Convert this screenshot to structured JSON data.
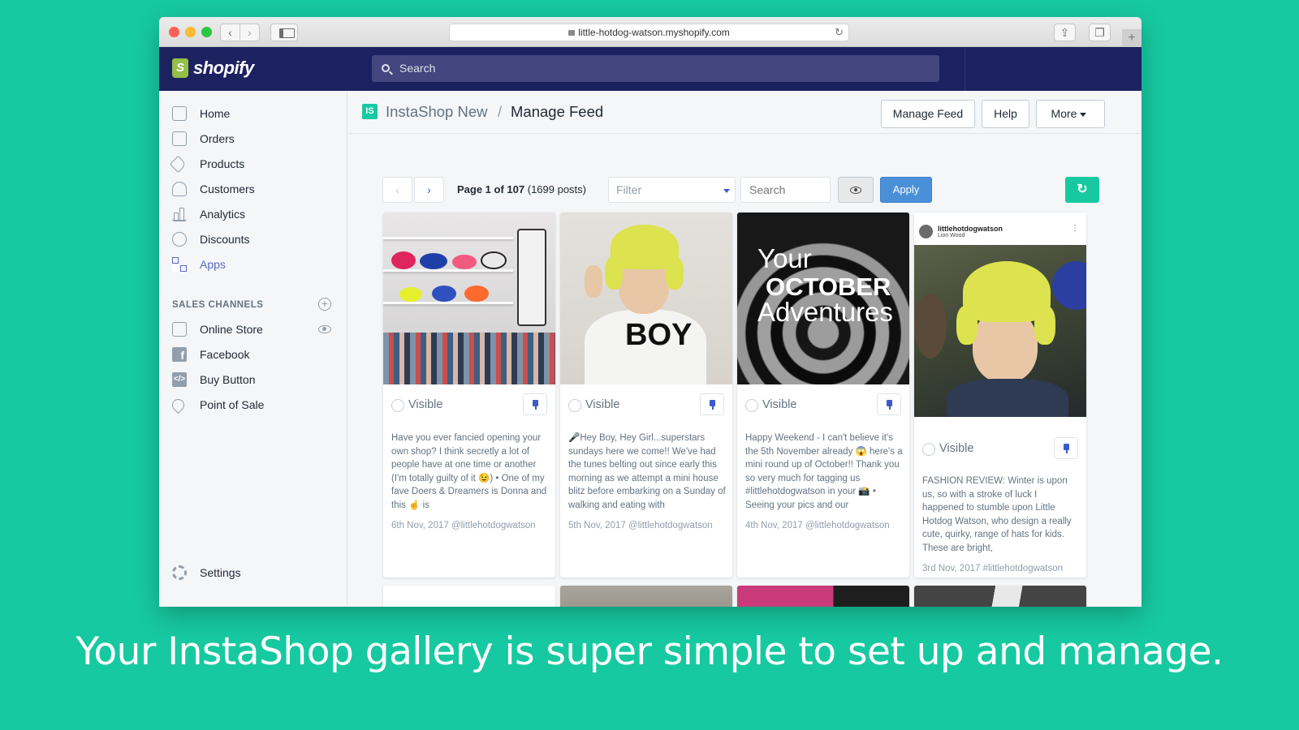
{
  "browser": {
    "url": "little-hotdog-watson.myshopify.com"
  },
  "shopify": {
    "logo_text": "shopify",
    "search_placeholder": "Search"
  },
  "sidebar": {
    "items": [
      {
        "label": "Home",
        "icon": "home-icon"
      },
      {
        "label": "Orders",
        "icon": "orders-icon"
      },
      {
        "label": "Products",
        "icon": "tag-icon"
      },
      {
        "label": "Customers",
        "icon": "person-icon"
      },
      {
        "label": "Analytics",
        "icon": "bar-chart-icon"
      },
      {
        "label": "Discounts",
        "icon": "discount-icon"
      },
      {
        "label": "Apps",
        "icon": "apps-icon",
        "active": true
      }
    ],
    "sales_channels_title": "SALES CHANNELS",
    "channels": [
      {
        "label": "Online Store",
        "icon": "store-icon"
      },
      {
        "label": "Facebook",
        "icon": "facebook-icon"
      },
      {
        "label": "Buy Button",
        "icon": "code-icon"
      },
      {
        "label": "Point of Sale",
        "icon": "location-pin-icon"
      }
    ],
    "settings_label": "Settings"
  },
  "header": {
    "app_logo": "IS",
    "app_name": "InstaShop New",
    "separator": "/",
    "page_title": "Manage Feed",
    "buttons": {
      "manage_feed": "Manage Feed",
      "help": "Help",
      "more": "More"
    }
  },
  "toolbar": {
    "page_label": "Page 1 of 107",
    "post_count": "(1699 posts)",
    "filter_placeholder": "Filter",
    "search_placeholder": "Search",
    "apply_label": "Apply"
  },
  "posts": [
    {
      "visible_label": "Visible",
      "caption": "Have you ever fancied opening your own shop? I think secretly a lot of people have at one time or another (I'm totally guilty of it 😉) • One of my fave Doers & Dreamers is Donna and this ☝️ is",
      "date": "6th Nov, 2017 @littlehotdogwatson"
    },
    {
      "visible_label": "Visible",
      "caption": "🎤Hey Boy, Hey Girl...superstars sundays here we come!! We've had the tunes belting out since early this morning as we attempt a mini house blitz before embarking on a Sunday of walking and eating with",
      "date": "5th Nov, 2017 @littlehotdogwatson",
      "image_text": "BOY"
    },
    {
      "visible_label": "Visible",
      "caption": "Happy Weekend - I can't believe it's the 5th November already 😱 here's a mini round up of October!! Thank you so very much for tagging us #littlehotdogwatson in your 📸 • Seeing your pics and our",
      "date": "4th Nov, 2017 @littlehotdogwatson",
      "image_text": {
        "line1": "Your",
        "line2": "OCTOBER",
        "line3": "Adventures"
      }
    },
    {
      "visible_label": "Visible",
      "caption": "FASHION REVIEW: Winter is upon us, so with a stroke of luck I happened to stumble upon Little Hotdog Watson, who design a really cute, quirky, range of hats for kids. These are bright,",
      "date": "3rd Nov, 2017 #littlehotdogwatson",
      "insta_user": "littlehotdogwatson",
      "insta_location": "Lion Wood"
    }
  ],
  "tagline": "Your InstaShop gallery is super simple to set up and manage.",
  "colors": {
    "background": "#17c9a0",
    "topbar": "#1c2260",
    "accent": "#5c6ac4",
    "apply": "#4a90d9"
  }
}
